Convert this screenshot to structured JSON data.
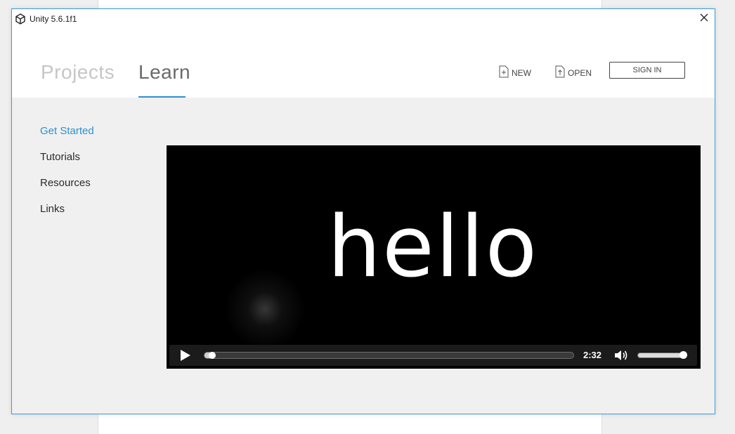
{
  "window": {
    "title": "Unity 5.6.1f1",
    "close_glyph": "✕",
    "accent_color": "#2f8fd0"
  },
  "header": {
    "tabs": [
      {
        "label": "Projects",
        "active": false
      },
      {
        "label": "Learn",
        "active": true
      }
    ],
    "actions": {
      "new_label": "NEW",
      "open_label": "OPEN",
      "sign_in_label": "SIGN IN"
    }
  },
  "sidebar": {
    "items": [
      {
        "label": "Get Started",
        "active": true
      },
      {
        "label": "Tutorials",
        "active": false
      },
      {
        "label": "Resources",
        "active": false
      },
      {
        "label": "Links",
        "active": false
      }
    ]
  },
  "video": {
    "title_text": "hello",
    "time": "2:32",
    "progress": 0.02,
    "volume": 0.95,
    "icons": [
      "play-icon",
      "volume-icon"
    ]
  }
}
